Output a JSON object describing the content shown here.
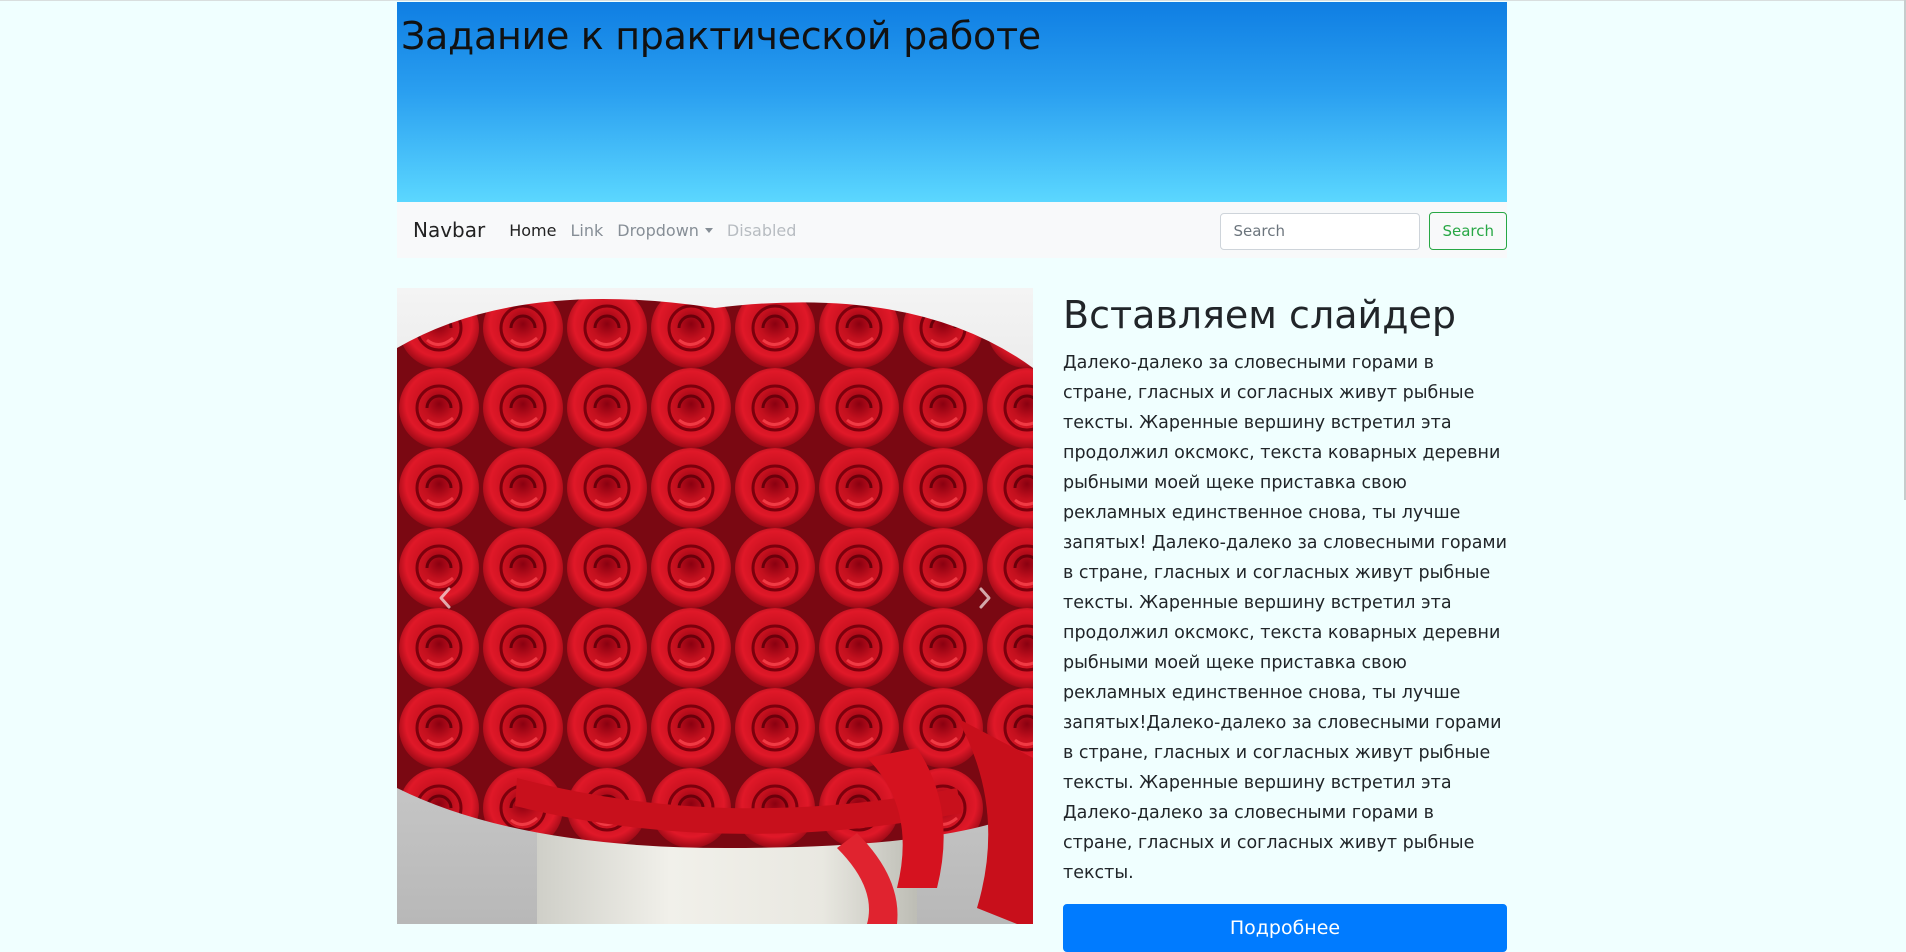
{
  "header": {
    "title": "Задание к практической работе"
  },
  "navbar": {
    "brand": "Navbar",
    "items": [
      {
        "label": "Home",
        "state": "active"
      },
      {
        "label": "Link",
        "state": "normal"
      },
      {
        "label": "Dropdown",
        "state": "normal"
      },
      {
        "label": "Disabled",
        "state": "disabled"
      }
    ],
    "search_placeholder": "Search",
    "search_button": "Search"
  },
  "carousel": {
    "image": "red-roses-in-white-hatbox",
    "prev_icon": "chevron-left-icon",
    "next_icon": "chevron-right-icon"
  },
  "content": {
    "heading": "Вставляем слайдер",
    "body": "Далеко-далеко за словесными горами в стране, гласных и согласных живут рыбные тексты. Жаренные вершину встретил эта продолжил оксмокс, текста коварных деревни рыбными моей щеке приставка свою рекламных единственное снова, ты лучше запятых! Далеко-далеко за словесными горами в стране, гласных и согласных живут рыбные тексты. Жаренные вершину встретил эта продолжил оксмокс, текста коварных деревни рыбными моей щеке приставка свою рекламных единственное снова, ты лучше запятых!Далеко-далеко за словесными горами в стране, гласных и согласных живут рыбные тексты. Жаренные вершину встретил эта Далеко-далеко за словесными горами в стране, гласных и согласных живут рыбные тексты.",
    "button_label": "Подробнее"
  },
  "colors": {
    "page_background": "#f0ffff",
    "header_gradient_top": "#0f7ee3",
    "header_gradient_bottom": "#5bd7ff",
    "primary": "#007bff",
    "success": "#28a745"
  }
}
